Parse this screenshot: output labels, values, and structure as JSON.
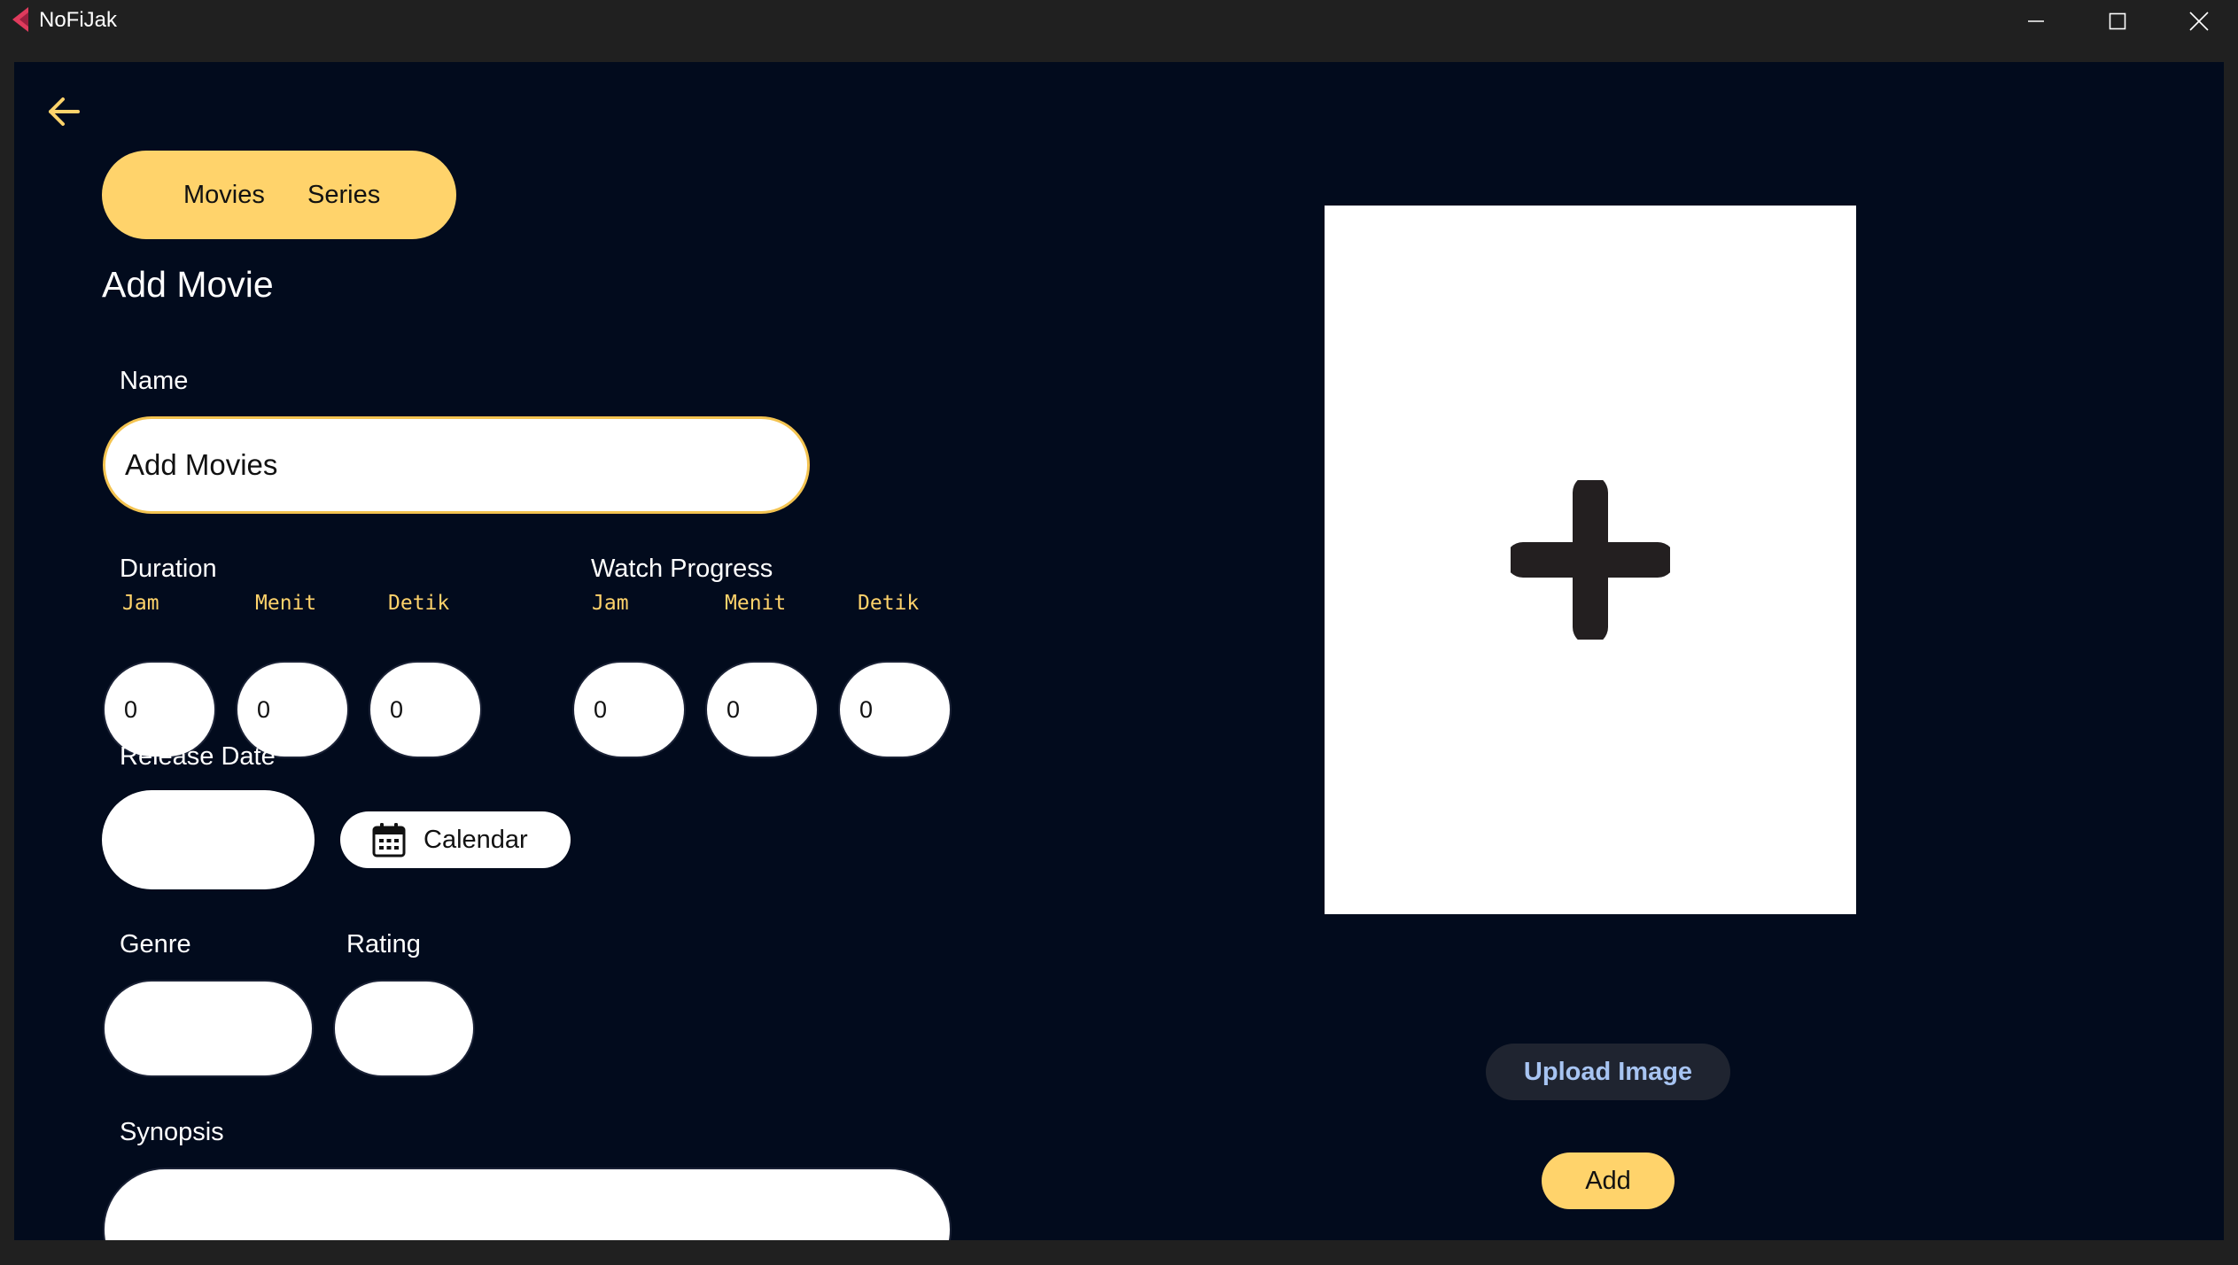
{
  "window": {
    "title": "NoFiJak"
  },
  "colors": {
    "accent": "#ffd36b",
    "background": "#020b1d",
    "link": "#a7c4f2"
  },
  "icons": {
    "back": "arrow-left-icon",
    "calendar": "calendar-icon",
    "add_image": "plus-icon"
  },
  "nav": {
    "tabs": [
      {
        "label": "Movies"
      },
      {
        "label": "Series"
      }
    ]
  },
  "page": {
    "title": "Add Movie"
  },
  "form": {
    "name": {
      "label": "Name",
      "value": "Add Movies"
    },
    "duration": {
      "label": "Duration",
      "fields": [
        {
          "label": "Jam",
          "value": "0"
        },
        {
          "label": "Menit",
          "value": "0"
        },
        {
          "label": "Detik",
          "value": "0"
        }
      ]
    },
    "watch_progress": {
      "label": "Watch Progress",
      "fields": [
        {
          "label": "Jam",
          "value": "0"
        },
        {
          "label": "Menit",
          "value": "0"
        },
        {
          "label": "Detik",
          "value": "0"
        }
      ]
    },
    "release_date": {
      "label": "Release Date",
      "value": "",
      "calendar_label": "Calendar"
    },
    "genre": {
      "label": "Genre",
      "value": ""
    },
    "rating": {
      "label": "Rating",
      "value": ""
    },
    "synopsis": {
      "label": "Synopsis",
      "value": ""
    }
  },
  "image_panel": {
    "upload_label": "Upload Image",
    "add_label": "Add"
  }
}
